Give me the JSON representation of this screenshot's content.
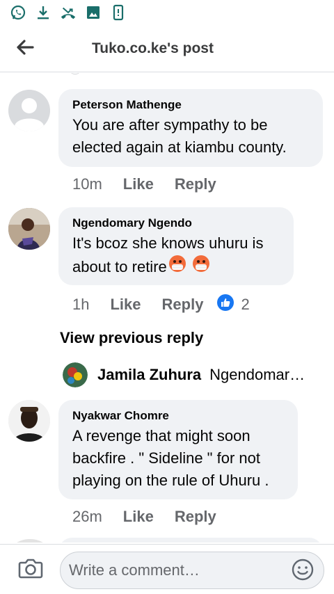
{
  "status_bar": {
    "icons": [
      "whatsapp-icon",
      "download-icon",
      "missed-call-icon",
      "image-icon",
      "phone-vibrate-icon"
    ],
    "icon_color": "#1a6e6a"
  },
  "header": {
    "title": "Tuko.co.ke's post",
    "back_icon": "arrow-left-icon"
  },
  "comments": [
    {
      "author": "Peterson Mathenge",
      "text_lines": [
        "You are after sympathy to be",
        "elected again at kiambu county."
      ],
      "time": "10m",
      "like_label": "Like",
      "reply_label": "Reply",
      "avatar": "default-avatar"
    },
    {
      "author": "Ngendomary Ngendo",
      "text_lines": [
        "It's bcoz she knows uhuru is",
        "about to retire"
      ],
      "emojis": [
        "face-with-medical-mask",
        "face-with-medical-mask"
      ],
      "time": "1h",
      "like_label": "Like",
      "reply_label": "Reply",
      "like_count": "2",
      "avatar": "photo-avatar"
    },
    {
      "author": "Nyakwar Chomre",
      "text_lines": [
        "A revenge that might soon",
        "backfire . \" Sideline \" for not",
        "playing on the rule of Uhuru ."
      ],
      "time": "26m",
      "like_label": "Like",
      "reply_label": "Reply",
      "avatar": "photo-avatar"
    }
  ],
  "view_previous_reply": "View previous reply",
  "reply_preview": {
    "name": "Jamila Zuhura",
    "snippet": "Ngendomary Ngendo"
  },
  "composer": {
    "placeholder": "Write a comment…",
    "camera_icon": "camera-icon",
    "emoji_icon": "emoji-icon"
  },
  "colors": {
    "accent_blue": "#1877f2",
    "bubble_bg": "#f0f2f5",
    "meta_gray": "#65676b"
  }
}
